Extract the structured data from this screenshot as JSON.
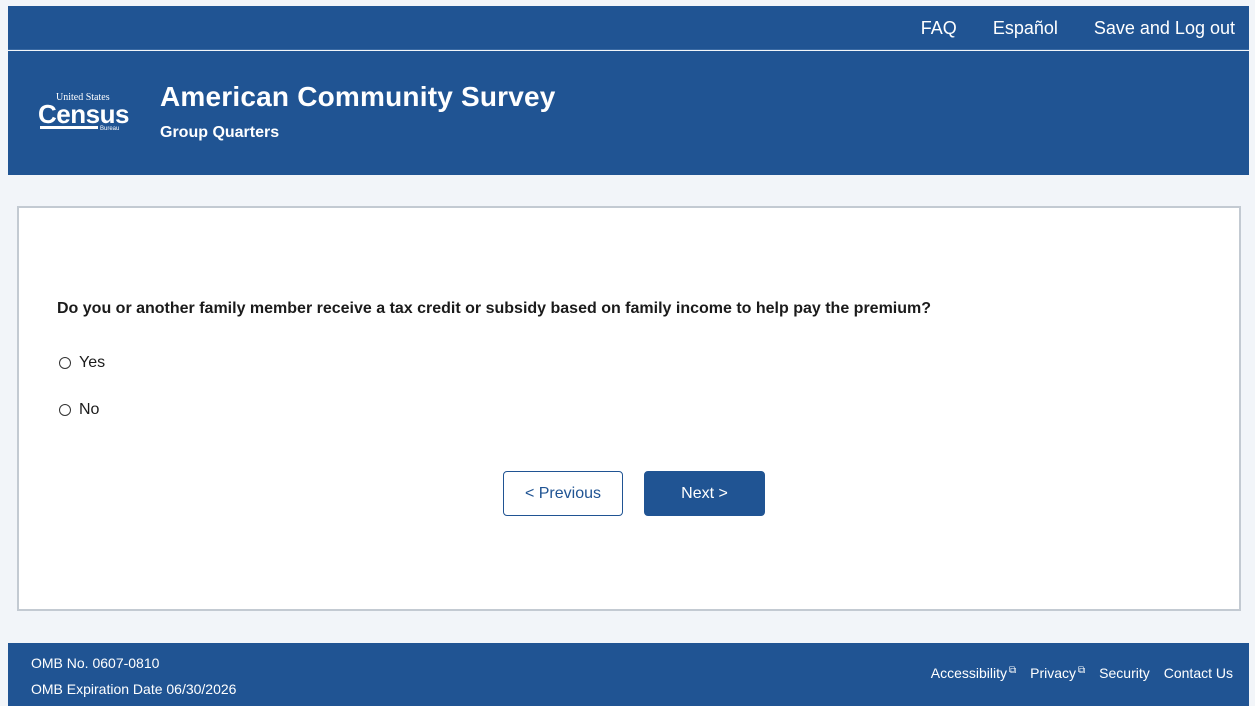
{
  "topnav": {
    "faq": "FAQ",
    "espanol": "Español",
    "save_logout": "Save and Log out"
  },
  "header": {
    "logo_line1": "United States",
    "logo_line2": "Census",
    "logo_line3": "Bureau",
    "title": "American Community Survey",
    "subtitle": "Group Quarters"
  },
  "question": {
    "text": "Do you or another family member receive a tax credit or subsidy based on family income to help pay the premium?",
    "options": [
      {
        "label": "Yes",
        "selected": false
      },
      {
        "label": "No",
        "selected": false
      }
    ]
  },
  "buttons": {
    "previous": "< Previous",
    "next": "Next >"
  },
  "footer": {
    "omb_number": "OMB No. 0607-0810",
    "omb_expiration": "OMB Expiration Date 06/30/2026",
    "links": {
      "accessibility": "Accessibility",
      "privacy": "Privacy",
      "security": "Security",
      "contact": "Contact Us"
    },
    "external_icon": "external-link-icon"
  },
  "colors": {
    "brand_blue": "#205493",
    "page_bg": "#f2f5f9",
    "card_border": "#c3cad2"
  }
}
